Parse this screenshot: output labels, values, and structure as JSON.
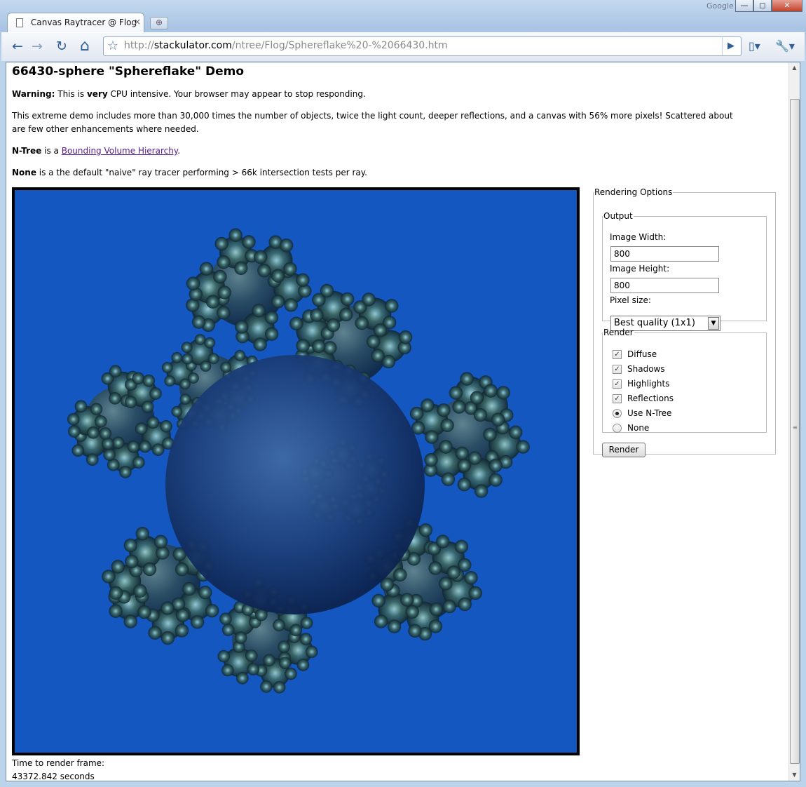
{
  "window": {
    "search_brand": "Google",
    "min_glyph": "—",
    "max_glyph": "◻",
    "close_glyph": "✕"
  },
  "tab": {
    "title": "Canvas Raytracer @ Flog",
    "close_glyph": "×",
    "new_tab_glyph": "⊕"
  },
  "toolbar": {
    "url_prefix": "http://",
    "url_domain": "stackulator.com",
    "url_path": "/ntree/Flog/Sphereflake%20-%2066430.htm",
    "back_glyph": "←",
    "forward_glyph": "→",
    "reload_glyph": "↻",
    "home_glyph": "⌂",
    "star_glyph": "☆",
    "go_glyph": "▶",
    "page_menu_glyph": "▯▾",
    "tools_menu_glyph": "🔧▾"
  },
  "page": {
    "heading": "66430-sphere \"Sphereflake\" Demo",
    "warning_label": "Warning:",
    "warning_text_1": " This is ",
    "warning_bold": "very",
    "warning_text_2": " CPU intensive. Your browser may appear to stop responding.",
    "description": "This extreme demo includes more than 30,000 times the number of objects, twice the light count, deeper reflections, and a canvas with 56% more pixels! Scattered about are few other enhancements where needed.",
    "ntree_label": "N-Tree",
    "ntree_text": " is a ",
    "ntree_link": "Bounding Volume Hierarchy",
    "ntree_end": ".",
    "none_label": "None",
    "none_text": " is a the default \"naive\" ray tracer performing > 66k intersection tests per ray.",
    "time_label": "Time to render frame:",
    "time_value": "43372.842 seconds"
  },
  "options": {
    "legend": "Rendering Options",
    "output_legend": "Output",
    "width_label": "Image Width:",
    "width_value": "800",
    "height_label": "Image Height:",
    "height_value": "800",
    "pixel_label": "Pixel size:",
    "pixel_value": "Best quality (1x1)",
    "render_legend": "Render",
    "diffuse": "Diffuse",
    "shadows": "Shadows",
    "highlights": "Highlights",
    "reflections": "Reflections",
    "use_ntree": "Use N-Tree",
    "none": "None",
    "check_glyph": "✓",
    "select_arrow": "▼",
    "render_button": "Render"
  },
  "colors": {
    "canvas_background": "#1457c0",
    "link": "#551a8b"
  }
}
